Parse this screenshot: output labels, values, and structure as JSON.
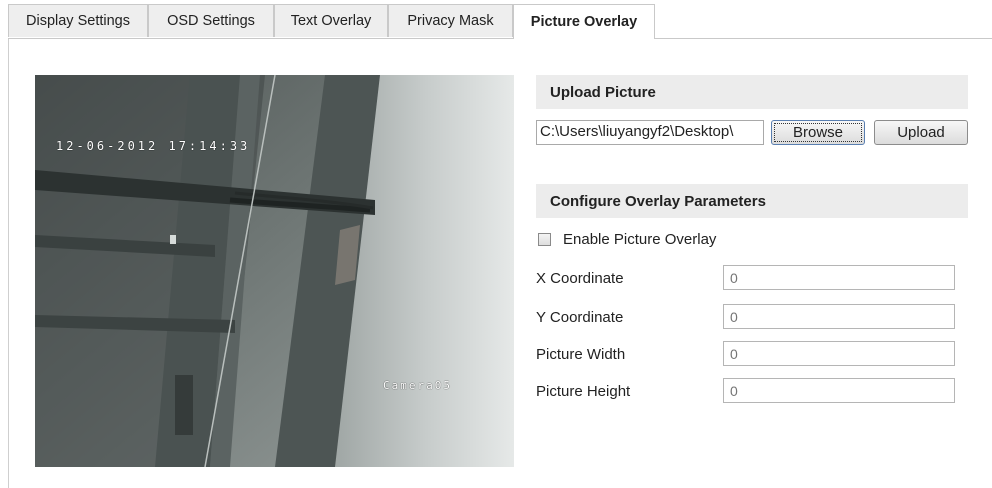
{
  "tabs": [
    {
      "label": "Display Settings"
    },
    {
      "label": "OSD Settings"
    },
    {
      "label": "Text Overlay"
    },
    {
      "label": "Privacy Mask"
    },
    {
      "label": "Picture Overlay",
      "active": true
    }
  ],
  "preview": {
    "datetime": "12-06-2012 17:14:33",
    "camera_name": "Camera05"
  },
  "upload": {
    "header": "Upload Picture",
    "file_path": "C:\\Users\\liuyangyf2\\Desktop\\",
    "browse_label": "Browse",
    "upload_label": "Upload"
  },
  "overlay": {
    "header": "Configure Overlay Parameters",
    "enable_label": "Enable Picture Overlay",
    "enabled": false,
    "fields": [
      {
        "label": "X Coordinate",
        "placeholder": "0"
      },
      {
        "label": "Y Coordinate",
        "placeholder": "0"
      },
      {
        "label": "Picture Width",
        "placeholder": "0"
      },
      {
        "label": "Picture Height",
        "placeholder": "0"
      }
    ]
  }
}
